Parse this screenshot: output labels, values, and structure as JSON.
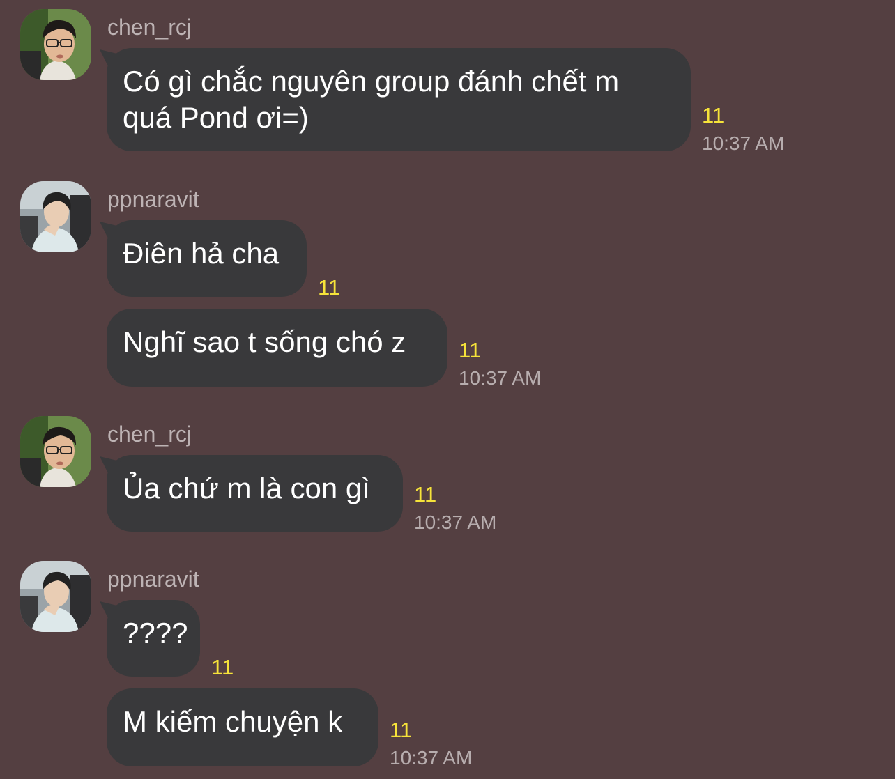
{
  "chat": {
    "groups": [
      {
        "sender": "chen_rcj",
        "avatar": "avatar-chen-rcj",
        "messages": [
          {
            "text": "Có gì chắc nguyên group đánh chết m\nquá Pond ơi=)",
            "read_count": "11",
            "time": "10:37 AM"
          }
        ]
      },
      {
        "sender": "ppnaravit",
        "avatar": "avatar-ppnaravit",
        "messages": [
          {
            "text": "Điên hả cha",
            "read_count": "11",
            "time": ""
          },
          {
            "text": "Nghĩ sao t sống chó z",
            "read_count": "11",
            "time": "10:37 AM"
          }
        ]
      },
      {
        "sender": "chen_rcj",
        "avatar": "avatar-chen-rcj",
        "messages": [
          {
            "text": "Ủa chứ m là con gì",
            "read_count": "11",
            "time": "10:37 AM"
          }
        ]
      },
      {
        "sender": "ppnaravit",
        "avatar": "avatar-ppnaravit",
        "messages": [
          {
            "text": "????",
            "read_count": "11",
            "time": ""
          },
          {
            "text": "M kiếm chuyện k",
            "read_count": "11",
            "time": "10:37 AM"
          }
        ]
      }
    ]
  },
  "colors": {
    "background": "#543f41",
    "bubble": "#39393b",
    "read_count": "#f6e33a",
    "timestamp": "#b7adae",
    "sender": "#bdb3b4"
  }
}
